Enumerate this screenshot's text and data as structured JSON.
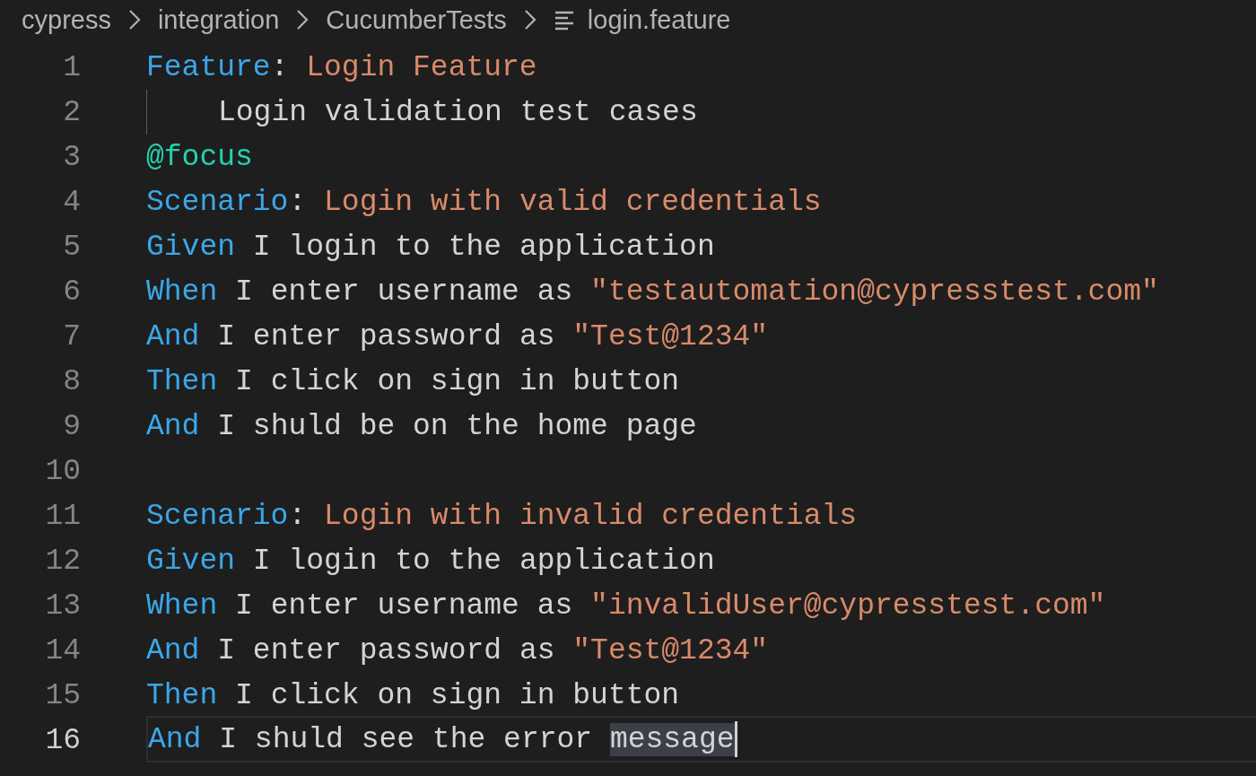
{
  "breadcrumb": [
    {
      "text": "cypress",
      "kind": "folder"
    },
    {
      "text": "integration",
      "kind": "folder"
    },
    {
      "text": "CucumberTests",
      "kind": "folder"
    },
    {
      "text": "login.feature",
      "kind": "file"
    }
  ],
  "lines": [
    {
      "number": "1",
      "current": false,
      "indented": false,
      "tokens": [
        {
          "kind": "keyword",
          "text": "Feature"
        },
        {
          "kind": "plain",
          "text": ": "
        },
        {
          "kind": "title",
          "text": "Login Feature"
        }
      ]
    },
    {
      "number": "2",
      "current": false,
      "indented": true,
      "tokens": [
        {
          "kind": "plain",
          "text": "Login validation test cases"
        }
      ]
    },
    {
      "number": "3",
      "current": false,
      "indented": false,
      "tokens": [
        {
          "kind": "tag",
          "text": "@focus"
        }
      ]
    },
    {
      "number": "4",
      "current": false,
      "indented": false,
      "tokens": [
        {
          "kind": "keyword",
          "text": "Scenario"
        },
        {
          "kind": "plain",
          "text": ": "
        },
        {
          "kind": "title",
          "text": "Login with valid credentials"
        }
      ]
    },
    {
      "number": "5",
      "current": false,
      "indented": false,
      "tokens": [
        {
          "kind": "keyword",
          "text": "Given"
        },
        {
          "kind": "plain",
          "text": " I login to the application"
        }
      ]
    },
    {
      "number": "6",
      "current": false,
      "indented": false,
      "tokens": [
        {
          "kind": "keyword",
          "text": "When"
        },
        {
          "kind": "plain",
          "text": " I enter username as "
        },
        {
          "kind": "string",
          "text": "\"testautomation@cypresstest.com\""
        }
      ]
    },
    {
      "number": "7",
      "current": false,
      "indented": false,
      "tokens": [
        {
          "kind": "keyword",
          "text": "And"
        },
        {
          "kind": "plain",
          "text": " I enter password as "
        },
        {
          "kind": "string",
          "text": "\"Test@1234\""
        }
      ]
    },
    {
      "number": "8",
      "current": false,
      "indented": false,
      "tokens": [
        {
          "kind": "keyword",
          "text": "Then"
        },
        {
          "kind": "plain",
          "text": " I click on sign in button"
        }
      ]
    },
    {
      "number": "9",
      "current": false,
      "indented": false,
      "tokens": [
        {
          "kind": "keyword",
          "text": "And"
        },
        {
          "kind": "plain",
          "text": " I shuld be on the home page"
        }
      ]
    },
    {
      "number": "10",
      "current": false,
      "indented": false
    },
    {
      "number": "11",
      "current": false,
      "indented": false,
      "tokens": [
        {
          "kind": "keyword",
          "text": "Scenario"
        },
        {
          "kind": "plain",
          "text": ": "
        },
        {
          "kind": "title",
          "text": "Login with invalid credentials"
        }
      ]
    },
    {
      "number": "12",
      "current": false,
      "indented": false,
      "tokens": [
        {
          "kind": "keyword",
          "text": "Given"
        },
        {
          "kind": "plain",
          "text": " I login to the application"
        }
      ]
    },
    {
      "number": "13",
      "current": false,
      "indented": false,
      "tokens": [
        {
          "kind": "keyword",
          "text": "When"
        },
        {
          "kind": "plain",
          "text": " I enter username as "
        },
        {
          "kind": "string",
          "text": "\"invalidUser@cypresstest.com\""
        }
      ]
    },
    {
      "number": "14",
      "current": false,
      "indented": false,
      "tokens": [
        {
          "kind": "keyword",
          "text": "And"
        },
        {
          "kind": "plain",
          "text": " I enter password as "
        },
        {
          "kind": "string",
          "text": "\"Test@1234\""
        }
      ]
    },
    {
      "number": "15",
      "current": false,
      "indented": false,
      "tokens": [
        {
          "kind": "keyword",
          "text": "Then"
        },
        {
          "kind": "plain",
          "text": " I click on sign in button"
        }
      ]
    },
    {
      "number": "16",
      "current": true,
      "indented": false,
      "tokens": [
        {
          "kind": "keyword",
          "text": "And"
        },
        {
          "kind": "plain",
          "text": " I shuld see the error "
        },
        {
          "kind": "selection",
          "text": "message"
        }
      ]
    }
  ]
}
